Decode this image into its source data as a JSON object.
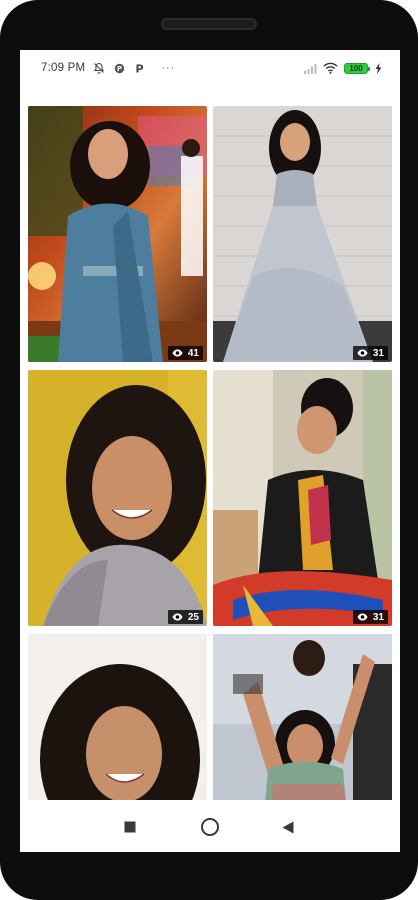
{
  "status_bar": {
    "time": "7:09 PM",
    "left_icons": [
      "alarm-off-icon",
      "p-circle-icon",
      "p-icon"
    ],
    "more": "···",
    "signal": "signal-icon",
    "wifi": "wifi-icon",
    "battery_level": "100"
  },
  "gallery": {
    "items": [
      {
        "views": "41",
        "photo": "woman in blue saree at event"
      },
      {
        "views": "31",
        "photo": "woman in grey gown"
      },
      {
        "views": "25",
        "photo": "smiling woman with curly hair, yellow background"
      },
      {
        "views": "31",
        "photo": "woman in black and multicolour saree"
      },
      {
        "views": "",
        "photo": "smiling woman with curly hair, white background"
      },
      {
        "views": "",
        "photo": "woman dancing in crowd"
      }
    ]
  },
  "nav_bar": {
    "recents": "stop-square-icon",
    "home": "home-circle-icon",
    "back": "back-triangle-icon"
  },
  "colors": {
    "frame": "#0d0d0d",
    "badge_bg": "#000000",
    "battery": "#2ecc40"
  }
}
